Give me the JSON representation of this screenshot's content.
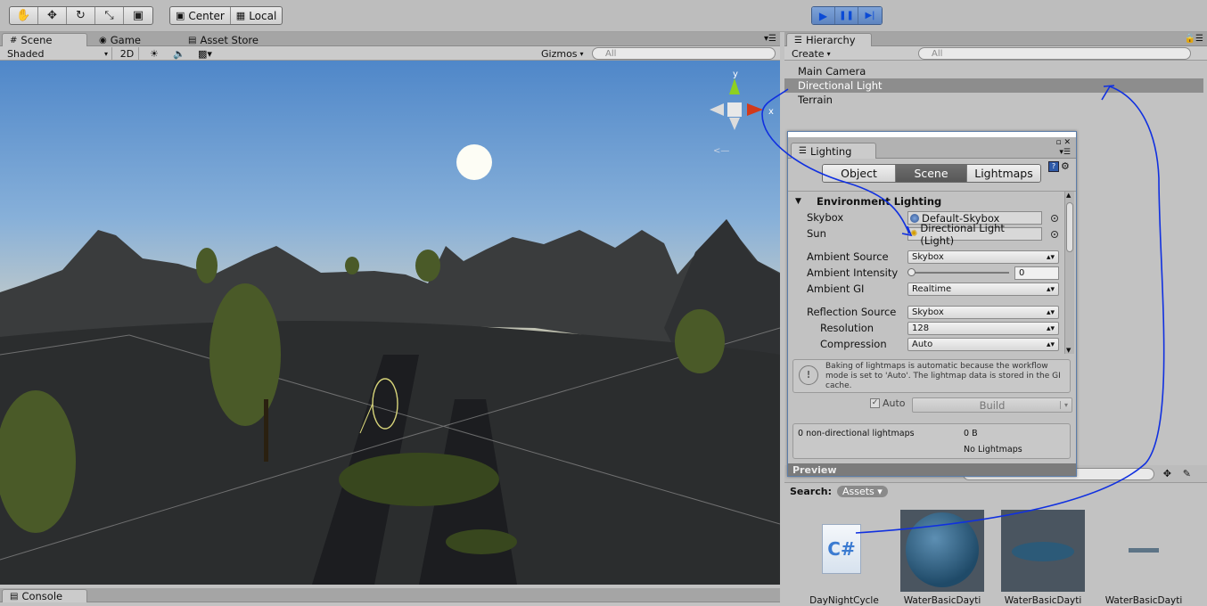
{
  "toolbar": {
    "tools": [
      {
        "name": "hand-tool",
        "glyph": "✋"
      },
      {
        "name": "move-tool",
        "glyph": "✥"
      },
      {
        "name": "rotate-tool",
        "glyph": "↻"
      },
      {
        "name": "scale-tool",
        "glyph": "⤡"
      },
      {
        "name": "rect-tool",
        "glyph": "▣"
      }
    ],
    "pivot_label": "Center",
    "space_label": "Local",
    "play_icon": "▶",
    "pause_icon": "❚❚",
    "step_icon": "▶|"
  },
  "scene_panel": {
    "tabs": [
      "Scene",
      "Game",
      "Asset Store"
    ],
    "shading_mode": "Shaded",
    "mode_2d": "2D",
    "gizmos_label": "Gizmos",
    "search_placeholder": "All",
    "gizmo_axes": {
      "y": "y",
      "x": "x"
    }
  },
  "hierarchy": {
    "tab": "Hierarchy",
    "create_label": "Create",
    "search_placeholder": "All",
    "items": [
      "Main Camera",
      "Directional Light",
      "Terrain"
    ],
    "selected": "Directional Light"
  },
  "lighting": {
    "tab": "Lighting",
    "segments": [
      "Object",
      "Scene",
      "Lightmaps"
    ],
    "active_segment": "Scene",
    "section_title": "Environment Lighting",
    "skybox_label": "Skybox",
    "skybox_value": "Default-Skybox",
    "sun_label": "Sun",
    "sun_value": "Directional Light (Light)",
    "ambient_source_label": "Ambient Source",
    "ambient_source_value": "Skybox",
    "ambient_intensity_label": "Ambient Intensity",
    "ambient_intensity_value": "0",
    "ambient_gi_label": "Ambient GI",
    "ambient_gi_value": "Realtime",
    "reflection_source_label": "Reflection Source",
    "reflection_source_value": "Skybox",
    "resolution_label": "Resolution",
    "resolution_value": "128",
    "compression_label": "Compression",
    "compression_value": "Auto",
    "info_text": "Baking of lightmaps is automatic because the workflow mode is set to 'Auto'. The lightmap data is stored in the GI cache.",
    "auto_label": "Auto",
    "build_label": "Build",
    "lightmaps_count": "0 non-directional lightmaps",
    "lightmaps_size": "0 B",
    "no_lightmaps": "No Lightmaps",
    "preview_label": "Preview"
  },
  "project": {
    "search_label": "Search:",
    "assets_label": "Assets",
    "items": [
      "DayNightCycle",
      "WaterBasicDayti",
      "WaterBasicDayti",
      "WaterBasicDayti"
    ]
  },
  "console": {
    "tab": "Console"
  }
}
